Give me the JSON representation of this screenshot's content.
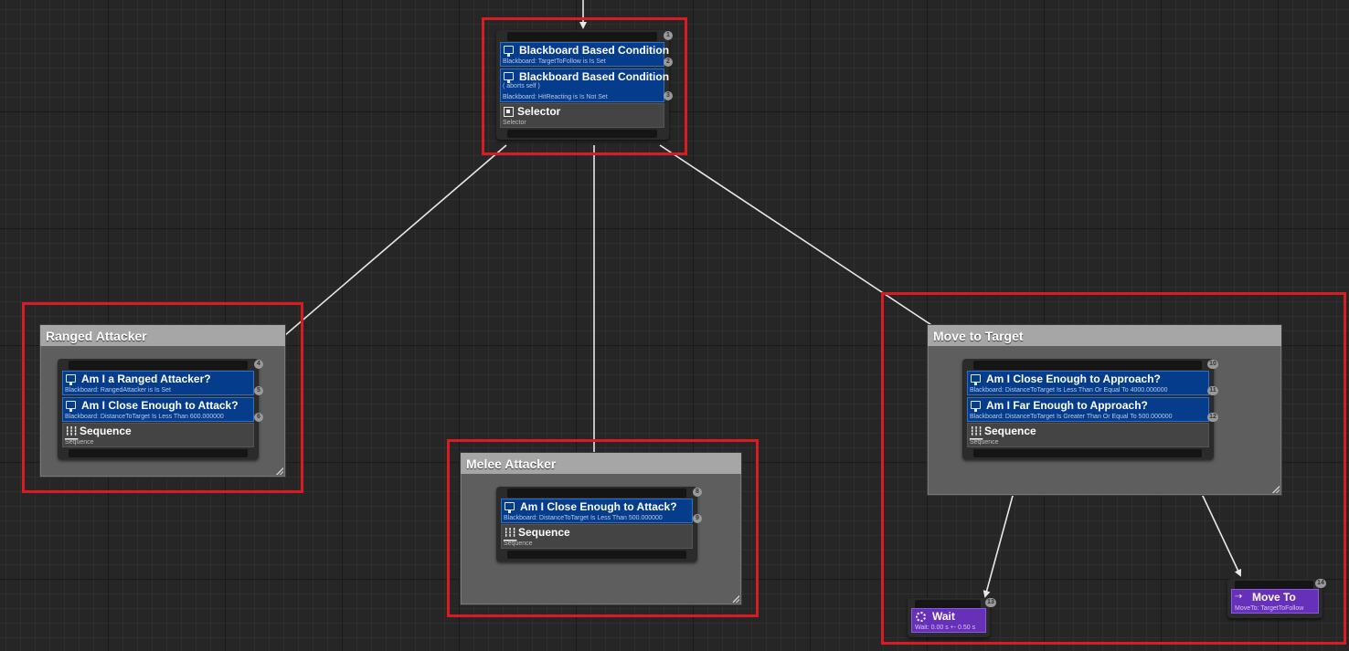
{
  "root_node": {
    "decorators": [
      {
        "title": "Blackboard Based Condition",
        "subtitle": "Blackboard: TargetToFollow is Is Set",
        "index": "2"
      },
      {
        "title": "Blackboard Based Condition",
        "note": "( aborts self )",
        "subtitle": "Blackboard: HitReacting is Is Not Set",
        "index": "3"
      }
    ],
    "composite": {
      "title": "Selector",
      "subtitle": "Selector",
      "icon": "selector-icon"
    },
    "index": "1"
  },
  "comments": {
    "ranged": "Ranged Attacker",
    "melee": "Melee Attacker",
    "move": "Move to Target"
  },
  "ranged_node": {
    "decorators": [
      {
        "title": "Am I a Ranged Attacker?",
        "subtitle": "Blackboard: RangedAttacker is Is Set",
        "index": "5"
      },
      {
        "title": "Am I Close Enough to Attack?",
        "subtitle": "Blackboard: DistanceToTarget Is Less Than 600.000000",
        "index": "6"
      }
    ],
    "composite": {
      "title": "Sequence",
      "subtitle": "Sequence",
      "icon": "sequence-icon"
    },
    "index": "4"
  },
  "melee_node": {
    "decorators": [
      {
        "title": "Am I Close Enough to Attack?",
        "subtitle": "Blackboard: DistanceToTarget Is Less Than 500.000000",
        "index": "9"
      }
    ],
    "composite": {
      "title": "Sequence",
      "subtitle": "Sequence",
      "icon": "sequence-icon"
    },
    "index": "8"
  },
  "move_node": {
    "decorators": [
      {
        "title": "Am I Close Enough to Approach?",
        "subtitle": "Blackboard: DistanceToTarget Is Less Than Or Equal To 4000.000000",
        "index": "11"
      },
      {
        "title": "Am I Far Enough to Approach?",
        "subtitle": "Blackboard: DistanceToTarget Is Greater Than Or Equal To 500.000000",
        "index": "12"
      }
    ],
    "composite": {
      "title": "Sequence",
      "subtitle": "Sequence",
      "icon": "sequence-icon"
    },
    "index": "10"
  },
  "wait_task": {
    "title": "Wait",
    "subtitle": "Wait: 0.00 s +- 0.50 s",
    "index": "13",
    "icon": "wait-icon"
  },
  "move_task": {
    "title": "Move To",
    "subtitle": "MoveTo: TargetToFollow",
    "index": "14",
    "icon": "move-to-icon"
  },
  "colors": {
    "highlight": "#d81c22",
    "decorator": "#053c8c",
    "task": "#6730b8",
    "composite": "#444444",
    "comment_header": "#a6a6a6",
    "comment_body": "#5e5e5e",
    "wire": "#e8e8e8"
  }
}
